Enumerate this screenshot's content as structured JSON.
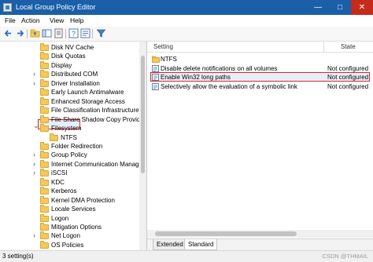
{
  "window": {
    "title": "Local Group Policy Editor"
  },
  "menu": [
    "File",
    "Action",
    "View",
    "Help"
  ],
  "toolbar": {
    "buttons": [
      "back-icon",
      "forward-icon",
      "up-folder-icon",
      "show-hide-tree-icon",
      "export-list-icon",
      "help-icon",
      "properties-icon",
      "filter-icon"
    ]
  },
  "tree": [
    {
      "label": "Disk NV Cache",
      "expandable": false,
      "indent": 0
    },
    {
      "label": "Disk Quotas",
      "expandable": false,
      "indent": 0
    },
    {
      "label": "Display",
      "expandable": false,
      "indent": 0
    },
    {
      "label": "Distributed COM",
      "expandable": true,
      "indent": 0
    },
    {
      "label": "Driver Installation",
      "expandable": true,
      "indent": 0
    },
    {
      "label": "Early Launch Antimalware",
      "expandable": false,
      "indent": 0
    },
    {
      "label": "Enhanced Storage Access",
      "expandable": false,
      "indent": 0
    },
    {
      "label": "File Classification Infrastructure",
      "expandable": false,
      "indent": 0
    },
    {
      "label": "File Share Shadow Copy Provider",
      "expandable": false,
      "indent": 0
    },
    {
      "label": "Filesystem",
      "expandable": true,
      "expanded": true,
      "selected": true,
      "indent": 0
    },
    {
      "label": "NTFS",
      "expandable": false,
      "indent": 1
    },
    {
      "label": "Folder Redirection",
      "expandable": false,
      "indent": 0
    },
    {
      "label": "Group Policy",
      "expandable": true,
      "indent": 0
    },
    {
      "label": "Internet Communication Manage",
      "expandable": true,
      "indent": 0
    },
    {
      "label": "iSCSI",
      "expandable": true,
      "indent": 0
    },
    {
      "label": "KDC",
      "expandable": false,
      "indent": 0
    },
    {
      "label": "Kerberos",
      "expandable": false,
      "indent": 0
    },
    {
      "label": "Kernel DMA Protection",
      "expandable": false,
      "indent": 0
    },
    {
      "label": "Locale Services",
      "expandable": false,
      "indent": 0
    },
    {
      "label": "Logon",
      "expandable": false,
      "indent": 0
    },
    {
      "label": "Mitigation Options",
      "expandable": false,
      "indent": 0
    },
    {
      "label": "Net Logon",
      "expandable": true,
      "indent": 0
    },
    {
      "label": "OS Policies",
      "expandable": false,
      "indent": 0
    }
  ],
  "list": {
    "columns": {
      "setting": "Setting",
      "state": "State"
    },
    "rows": [
      {
        "label": "NTFS",
        "state": "",
        "icon": "folder-icon"
      },
      {
        "label": "Disable delete notifications on all volumes",
        "state": "Not configured",
        "icon": "policy-setting-icon"
      },
      {
        "label": "Enable Win32 long paths",
        "state": "Not configured",
        "icon": "policy-setting-icon",
        "selected": true
      },
      {
        "label": "Selectively allow the evaluation of a symbolic link",
        "state": "Not configured",
        "icon": "policy-setting-icon"
      }
    ]
  },
  "tabs": [
    "Extended",
    "Standard"
  ],
  "status": {
    "text": "3 setting(s)"
  },
  "watermark": "CSDN @THMAIL"
}
